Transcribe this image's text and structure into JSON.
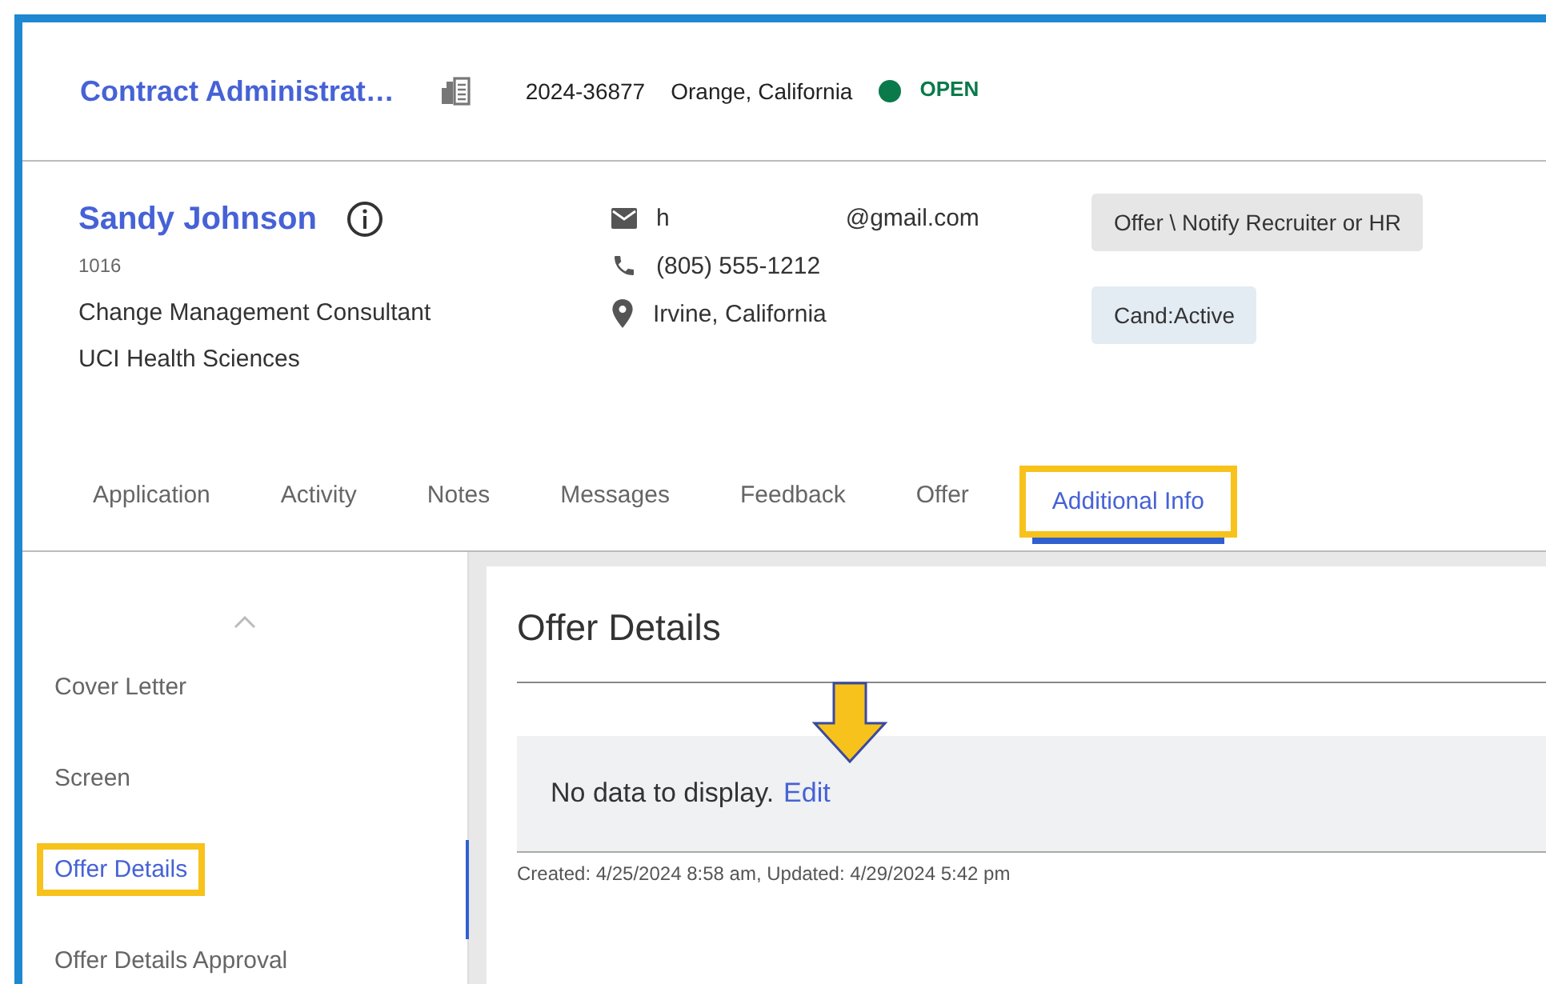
{
  "header": {
    "title": "Contract Administrat…",
    "requisition_id": "2024-36877",
    "location": "Orange, California",
    "status": {
      "label": "OPEN",
      "color": "#0a7a4a"
    }
  },
  "candidate": {
    "name": "Sandy Johnson",
    "id": "1016",
    "position": "Change Management Consultant",
    "department": "UCI Health Sciences",
    "email_start": "h",
    "email_end": "@gmail.com",
    "phone": "(805) 555-1212",
    "city": "Irvine, California",
    "badges": [
      {
        "label": "Offer \\ Notify Recruiter or HR",
        "kind": "step"
      },
      {
        "label": "Cand:Active",
        "kind": "status"
      }
    ]
  },
  "tabs": [
    {
      "label": "Application",
      "selected": false,
      "highlighted": false
    },
    {
      "label": "Activity",
      "selected": false,
      "highlighted": false
    },
    {
      "label": "Notes",
      "selected": false,
      "highlighted": false
    },
    {
      "label": "Messages",
      "selected": false,
      "highlighted": false
    },
    {
      "label": "Feedback",
      "selected": false,
      "highlighted": false
    },
    {
      "label": "Offer",
      "selected": false,
      "highlighted": false
    },
    {
      "label": "Additional Info",
      "selected": true,
      "highlighted": true
    }
  ],
  "sidebar": {
    "items": [
      {
        "label": "Cover Letter",
        "selected": false,
        "highlighted": false
      },
      {
        "label": "Screen",
        "selected": false,
        "highlighted": false
      },
      {
        "label": "Offer Details",
        "selected": true,
        "highlighted": true
      },
      {
        "label": "Offer Details Approval",
        "selected": false,
        "highlighted": false
      }
    ]
  },
  "panel": {
    "title": "Offer Details",
    "empty_text": "No data to display.",
    "edit_link": "Edit",
    "footer": "Created: 4/25/2024 8:58 am, Updated: 4/29/2024 5:42 pm"
  }
}
